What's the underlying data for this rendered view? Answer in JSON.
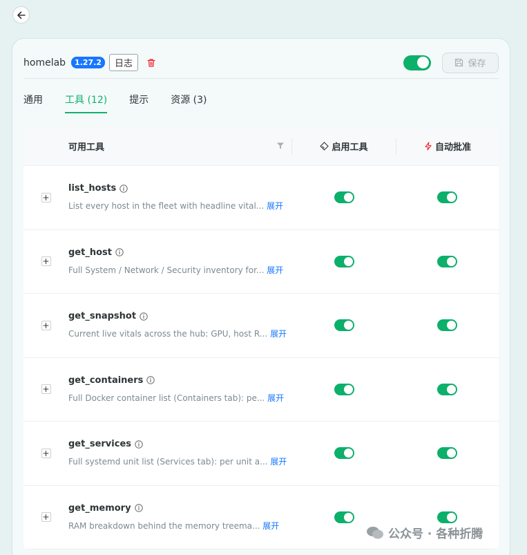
{
  "header": {
    "server_name": "homelab",
    "version": "1.27.2",
    "log_label": "日志",
    "save_label": "保存"
  },
  "tabs": [
    {
      "label": "通用"
    },
    {
      "label": "工具 (12)"
    },
    {
      "label": "提示"
    },
    {
      "label": "资源 (3)"
    }
  ],
  "table": {
    "col_tools": "可用工具",
    "col_enable": "启用工具",
    "col_auto": "自动批准",
    "more_label": "展开",
    "rows": [
      {
        "name": "list_hosts",
        "desc": "List every host in the fleet with headline vital..."
      },
      {
        "name": "get_host",
        "desc": "Full System / Network / Security inventory for..."
      },
      {
        "name": "get_snapshot",
        "desc": "Current live vitals across the hub: GPU, host R..."
      },
      {
        "name": "get_containers",
        "desc": "Full Docker container list (Containers tab): pe..."
      },
      {
        "name": "get_services",
        "desc": "Full systemd unit list (Services tab): per unit a..."
      },
      {
        "name": "get_memory",
        "desc": "RAM breakdown behind the memory treema..."
      }
    ]
  },
  "watermark": "公众号 · 各种折腾",
  "colors": {
    "accent": "#0fb26c",
    "brand_blue": "#1677ff",
    "danger": "#f5222d"
  }
}
